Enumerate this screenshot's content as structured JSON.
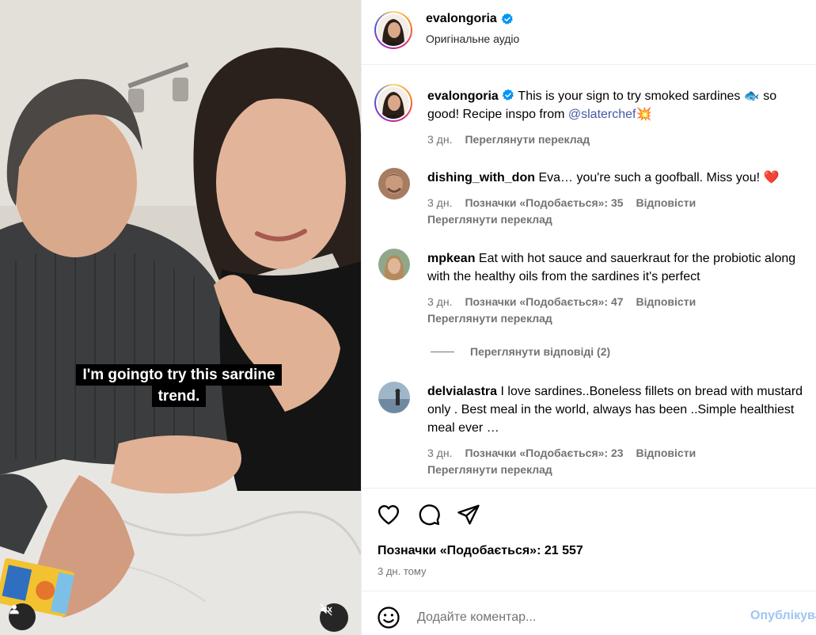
{
  "video": {
    "caption_line1": "I'm goingto try this sardine",
    "caption_line2": "trend."
  },
  "post_header": {
    "username": "evalongoria",
    "audio": "Оригінальне аудіо"
  },
  "caption": {
    "username": "evalongoria",
    "text_before": "This is your sign to try smoked sardines 🐟 so good! Recipe inspo from ",
    "mention": "@slaterchef",
    "text_after": "💥",
    "time": "3 дн.",
    "translate": "Переглянути переклад"
  },
  "comments": [
    {
      "username": "dishing_with_don",
      "text": "Eva… you're such a goofball. Miss you! ❤️",
      "time": "3 дн.",
      "likes": "Позначки «Подобається»: 35",
      "reply": "Відповісти",
      "translate": "Переглянути переклад"
    },
    {
      "username": "mpkean",
      "text": "Eat with hot sauce and sauerkraut for the probiotic along with the healthy oils from the sardines it's perfect",
      "time": "3 дн.",
      "likes": "Позначки «Подобається»: 47",
      "reply": "Відповісти",
      "translate": "Переглянути переклад",
      "view_replies": "Переглянути відповіді (2)"
    },
    {
      "username": "delvialastra",
      "text": "I love sardines..Boneless fillets on bread with mustard only . Best meal in the world, always has been ..Simple healthiest meal ever …",
      "time": "3 дн.",
      "likes": "Позначки «Подобається»: 23",
      "reply": "Відповісти",
      "translate": "Переглянути переклад"
    }
  ],
  "actions": {
    "likes": "Позначки «Подобається»: 21 557",
    "time_ago": "3 дн. тому"
  },
  "add_comment": {
    "placeholder": "Додайте коментар...",
    "publish": "Опублікувати"
  },
  "colors": {
    "verified": "#0095f6",
    "mention": "#4459a8",
    "muted_text": "#737373",
    "publish_disabled": "#a0c4f5"
  },
  "icons": [
    "verified-badge-icon",
    "heart-icon",
    "comment-icon",
    "share-icon",
    "emoji-icon",
    "user-tag-icon",
    "speaker-muted-icon"
  ]
}
